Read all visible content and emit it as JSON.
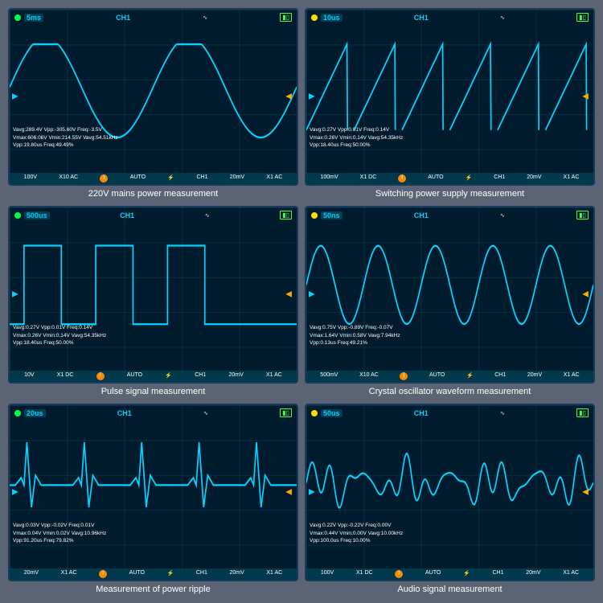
{
  "cells": [
    {
      "id": "cell-220v",
      "timebase": "5ms",
      "channel": "CH1",
      "measurements": [
        "Vavg:289.4V   Vpp:-305.60V   Freq:-3.5V",
        "Vmax:606.06V  Vmin:214.55V   Vavg:54.51kHz",
        "Vpp:19.80us                  Freq:49.49%"
      ],
      "footer_scale": "100V",
      "footer_probe": "X10 AC",
      "footer_auto": "AUTO",
      "footer_ch": "CH1",
      "footer_mv": "20mV",
      "footer_x1": "X1 AC",
      "caption": "220V mains power\nmeasurement",
      "waveform": "sine_clipped",
      "dot_color": "green"
    },
    {
      "id": "cell-switching",
      "timebase": "10us",
      "channel": "CH1",
      "measurements": [
        "Vavg:0.27V    Vpp:0.01V    Freq:0.14V",
        "Vmax:0.26V    Vmin:0.14V   Vavg:54.35kHz",
        "Vpp:18.40us                Freq:50.00%"
      ],
      "footer_scale": "100mV",
      "footer_probe": "X1 DC",
      "footer_auto": "AUTO",
      "footer_ch": "CH1",
      "footer_mv": "20mV",
      "footer_x1": "X1 AC",
      "caption": "Switching power supply\nmeasurement",
      "waveform": "sawtooth",
      "dot_color": "yellow"
    },
    {
      "id": "cell-pulse",
      "timebase": "500us",
      "channel": "CH1",
      "measurements": [
        "Vavg:0.27V    Vpp:0.01V    Freq:0.14V",
        "Vmax:0.26V    Vmin:0.14V   Vavg:54.35kHz",
        "Vpp:18.40us                Freq:50.00%"
      ],
      "footer_scale": "10V",
      "footer_probe": "X1 DC",
      "footer_auto": "AUTO",
      "footer_ch": "CH1",
      "footer_mv": "20mV",
      "footer_x1": "X1 AC",
      "caption": "Pulse signal\nmeasurement",
      "waveform": "pulse",
      "dot_color": "green"
    },
    {
      "id": "cell-crystal",
      "timebase": "50ns",
      "channel": "CH1",
      "measurements": [
        "Vavg:0.75V    Vpp:-0.89V   Freq:-0.07V",
        "Vmax:1.64V    Vmin:0.58V   Vavg:7.94kHz",
        "Vpp:0.13us                 Freq:49.21%"
      ],
      "footer_scale": "500mV",
      "footer_probe": "X10 AC",
      "footer_auto": "AUTO",
      "footer_ch": "CH1",
      "footer_mv": "20mV",
      "footer_x1": "X1 AC",
      "caption": "Crystal oscillator waveform\nmeasurement",
      "waveform": "sine_multi",
      "dot_color": "yellow"
    },
    {
      "id": "cell-ripple",
      "timebase": "20us",
      "channel": "CH1",
      "measurements": [
        "Vavg:0.03V    Vpp:-0.02V   Freq:0.01V",
        "Vmax:0.04V    Vmin:0.02V   Vavg:10.96kHz",
        "Vpp:91.20us                Freq:79.82%"
      ],
      "footer_scale": "20mV",
      "footer_probe": "X1 AC",
      "footer_auto": "AUTO",
      "footer_ch": "CH1",
      "footer_mv": "20mV",
      "footer_x1": "X1 AC",
      "caption": "Measurement of\npower ripple",
      "waveform": "ecg",
      "dot_color": "green"
    },
    {
      "id": "cell-audio",
      "timebase": "50us",
      "channel": "CH1",
      "measurements": [
        "Vavg:0.22V    Vpp:-0.22V   Freq:0.00V",
        "Vmax:0.44V    Vmin:0.00V   Vavg:10.00kHz",
        "Vpp:100.0us                Freq:10.00%"
      ],
      "footer_scale": "100V",
      "footer_probe": "X1 DC",
      "footer_auto": "AUTO",
      "footer_ch": "CH1",
      "footer_mv": "20mV",
      "footer_x1": "X1 AC",
      "caption": "Audio signal\nmeasurement",
      "waveform": "audio",
      "dot_color": "yellow"
    }
  ]
}
